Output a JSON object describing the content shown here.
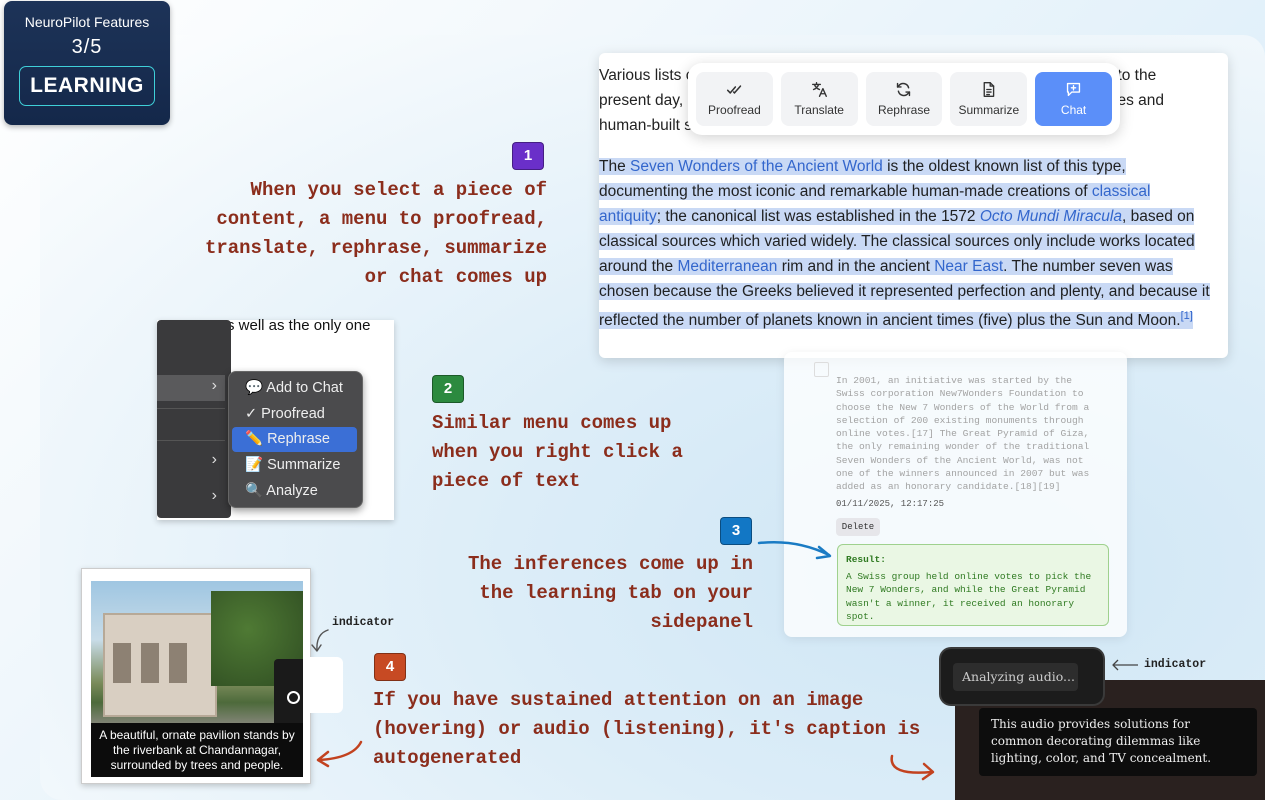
{
  "badge": {
    "title": "NeuroPilot Features",
    "progress": "3/5",
    "section": "LEARNING"
  },
  "steps": [
    {
      "num": "1",
      "color": "#6a2fc9",
      "text": "When you select a piece of content, a menu to proofread, translate, rephrase, summarize or chat comes up"
    },
    {
      "num": "2",
      "color": "#2c8a3f",
      "text": "Similar menu comes up when you right click a piece of text"
    },
    {
      "num": "3",
      "color": "#1277c5",
      "text": "The inferences come up in the learning tab on your sidepanel"
    },
    {
      "num": "4",
      "color": "#c74a23",
      "text": "If you have sustained attention on an image (hovering) or audio (listening), it's caption is autogenerated"
    }
  ],
  "article": {
    "intro_lines": [
      "Various lists c",
      "present day, i",
      "human-built s"
    ],
    "intro_right": [
      "to the",
      "es and",
      ""
    ],
    "para": {
      "t1": "The ",
      "l1": "Seven Wonders of the Ancient World",
      "t2": " is the oldest known list of this type, documenting the most iconic and remarkable human-made creations of ",
      "l2": "classical antiquity",
      "t3": "; the canonical list was established in the 1572 ",
      "l3": "Octo Mundi Miracula",
      "t4": ", based on classical sources which varied widely. The classical sources only include works located around the ",
      "l4": "Mediterranean",
      "t5": " rim and in the ancient ",
      "l5": "Near East",
      "t6": ". The number seven was chosen because the Greeks believed it represented perfection and plenty, and because it reflected the number of planets known in ancient times (five) plus the Sun and Moon.",
      "ref": "[1]"
    }
  },
  "toolbar": {
    "buttons": [
      {
        "label": "Proofread",
        "icon": "double-check-icon"
      },
      {
        "label": "Translate",
        "icon": "translate-icon"
      },
      {
        "label": "Rephrase",
        "icon": "refresh-icon"
      },
      {
        "label": "Summarize",
        "icon": "document-icon"
      },
      {
        "label": "Chat",
        "icon": "chat-plus-icon"
      }
    ]
  },
  "context_menu": {
    "top_text": "s well as the only one",
    "items": [
      {
        "label": "💬 Add to Chat"
      },
      {
        "label": "✓ Proofread"
      },
      {
        "label": "✏️ Rephrase"
      },
      {
        "label": "📝 Summarize"
      },
      {
        "label": "🔍 Analyze"
      }
    ]
  },
  "sidepanel": {
    "entry_text": "In 2001, an initiative was started by the Swiss corporation New7Wonders Foundation to choose the New 7 Wonders of the World from a selection of 200 existing monuments through online votes.[17] The Great Pyramid of Giza, the only remaining wonder of the traditional Seven Wonders of the Ancient World, was not one of the winners announced in 2007 but was added as an honorary candidate.[18][19]",
    "date": "01/11/2025, 12:17:25",
    "delete_label": "Delete",
    "result_label": "Result:",
    "result_text": "A Swiss group held online votes to pick the New 7 Wonders, and while the Great Pyramid wasn't a winner, it received an honorary spot."
  },
  "image_demo": {
    "caption": "A beautiful, ornate pavilion stands by the riverbank at Chandannagar, surrounded by trees and people.",
    "indicator_label": "indicator"
  },
  "audio_demo": {
    "status": "Analyzing audio...",
    "caption": "This audio provides solutions for common decorating dilemmas like lighting, color, and TV concealment.",
    "indicator_label": "indicator"
  }
}
